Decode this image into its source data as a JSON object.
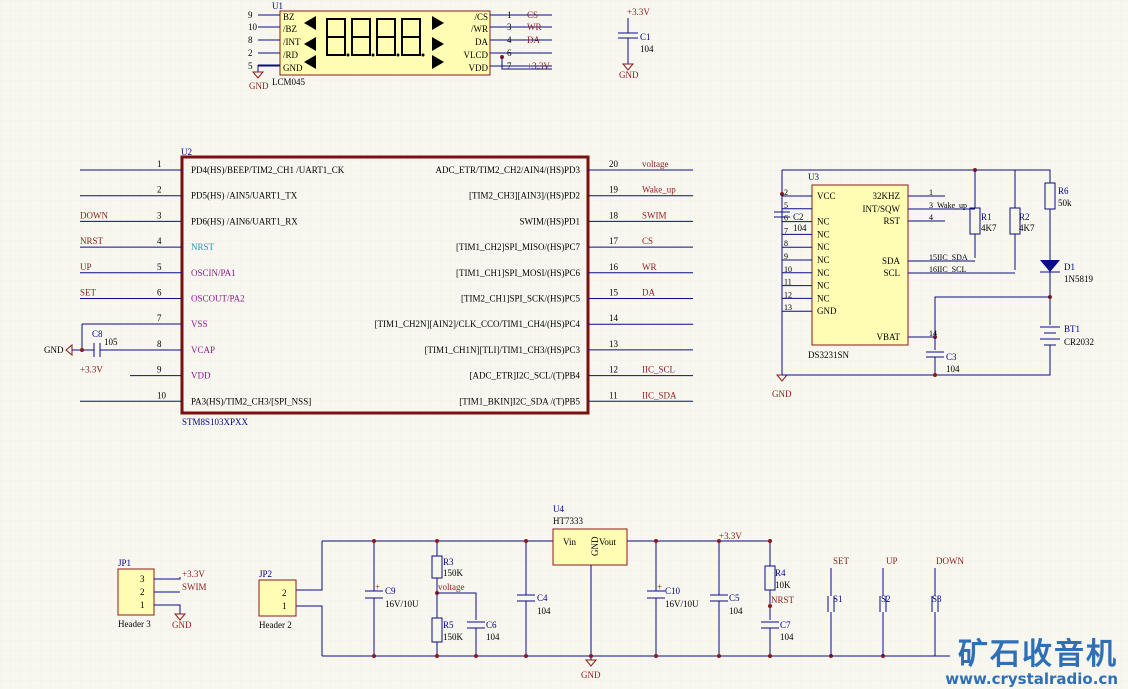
{
  "colors": {
    "wire": "#0b0b8c",
    "part_fill": "#fffdb4",
    "part_border": "#8b1a1a",
    "pin": "#000000",
    "label": "#000000",
    "ref": "#000080",
    "net": "#8b1a1a",
    "power": "#8b1a1a",
    "junction": "#8b1a1a",
    "mcu_border": "#7a1010",
    "watermark": "#2f6fb5"
  },
  "u1": {
    "ref": "U1",
    "value": "LCM045",
    "left_pins": [
      {
        "num": "9",
        "name": "BZ"
      },
      {
        "num": "10",
        "name": "/BZ"
      },
      {
        "num": "8",
        "name": "/INT"
      },
      {
        "num": "2",
        "name": "/RD"
      },
      {
        "num": "5",
        "name": "GND"
      }
    ],
    "right_pins": [
      {
        "num": "1",
        "name": "/CS",
        "net": "CS"
      },
      {
        "num": "3",
        "name": "/WR",
        "net": "WR"
      },
      {
        "num": "4",
        "name": "DA",
        "net": "DA"
      },
      {
        "num": "6",
        "name": "VLCD",
        "net": ""
      },
      {
        "num": "7",
        "name": "VDD",
        "net": "+3.3V"
      }
    ]
  },
  "gnd_label": "GND",
  "vcc_label": "+3.3V",
  "c1": {
    "ref": "C1",
    "value": "104"
  },
  "u2": {
    "ref": "U2",
    "value": "STM8S103XPXX",
    "left_pins": [
      {
        "num": "1",
        "name": "PD4(HS)/BEEP/TIM2_CH1 /UART1_CK",
        "net": ""
      },
      {
        "num": "2",
        "name": "PD5(HS) /AIN5/UART1_TX",
        "net": ""
      },
      {
        "num": "3",
        "name": "PD6(HS) /AIN6/UART1_RX",
        "net": "DOWN"
      },
      {
        "num": "4",
        "name": "NRST",
        "net": "NRST"
      },
      {
        "num": "5",
        "name": "OSCIN/PA1",
        "net": "UP"
      },
      {
        "num": "6",
        "name": "OSCOUT/PA2",
        "net": "SET"
      },
      {
        "num": "7",
        "name": "VSS",
        "net": ""
      },
      {
        "num": "8",
        "name": "VCAP",
        "net": ""
      },
      {
        "num": "9",
        "name": "VDD",
        "net": "+3.3V"
      },
      {
        "num": "10",
        "name": "PA3(HS)/TIM2_CH3/[SPI_NSS]",
        "net": ""
      }
    ],
    "right_pins": [
      {
        "num": "20",
        "name": "ADC_ETR/TIM2_CH2/AIN4/(HS)PD3",
        "net": "voltage"
      },
      {
        "num": "19",
        "name": "[TIM2_CH3][AIN3]/(HS)PD2",
        "net": "Wake_up"
      },
      {
        "num": "18",
        "name": "SWIM/(HS)PD1",
        "net": "SWIM"
      },
      {
        "num": "17",
        "name": "[TIM1_CH2]SPI_MISO/(HS)PC7",
        "net": "CS"
      },
      {
        "num": "16",
        "name": "[TIM1_CH1]SPI_MOSI/(HS)PC6",
        "net": "WR"
      },
      {
        "num": "15",
        "name": "[TIM2_CH1]SPI_SCK/(HS)PC5",
        "net": "DA"
      },
      {
        "num": "14",
        "name": "[TIM1_CH2N][AIN2]/CLK_CCO/TIM1_CH4/(HS)PC4",
        "net": ""
      },
      {
        "num": "13",
        "name": "[TIM1_CH1N][TLI]/TIM1_CH3/(HS)PC3",
        "net": ""
      },
      {
        "num": "12",
        "name": "[ADC_ETR]I2C_SCL/(T)PB4",
        "net": "IIC_SCL"
      },
      {
        "num": "11",
        "name": "[TIM1_BKIN]I2C_SDA /(T)PB5",
        "net": "IIC_SDA"
      }
    ]
  },
  "c8": {
    "ref": "C8",
    "value": "105"
  },
  "u3": {
    "ref": "U3",
    "value": "DS3231SN",
    "left_pins": [
      {
        "num": "2",
        "name": "VCC"
      },
      {
        "num": "5",
        "name": ""
      },
      {
        "num": "6",
        "name": "NC"
      },
      {
        "num": "7",
        "name": "NC"
      },
      {
        "num": "8",
        "name": "NC"
      },
      {
        "num": "9",
        "name": "NC"
      },
      {
        "num": "10",
        "name": "NC"
      },
      {
        "num": "11",
        "name": "NC"
      },
      {
        "num": "12",
        "name": "NC"
      },
      {
        "num": "13",
        "name": "GND"
      }
    ],
    "right_pins": [
      {
        "num": "1",
        "name": "32KHZ",
        "net": ""
      },
      {
        "num": "3",
        "name": "INT/SQW",
        "net": "Wake_up"
      },
      {
        "num": "4",
        "name": "RST",
        "net": ""
      },
      {
        "num": "15",
        "name": "SDA",
        "net": "IIC_SDA"
      },
      {
        "num": "16",
        "name": "SCL",
        "net": "IIC_SCL"
      },
      {
        "num": "14",
        "name": "VBAT",
        "net": ""
      }
    ]
  },
  "c2": {
    "ref": "C2",
    "value": "104"
  },
  "c3": {
    "ref": "C3",
    "value": "104"
  },
  "r1": {
    "ref": "R1",
    "value": "4K7"
  },
  "r2": {
    "ref": "R2",
    "value": "4K7"
  },
  "r6": {
    "ref": "R6",
    "value": "50k"
  },
  "d1": {
    "ref": "D1",
    "value": "1N5819"
  },
  "bt1": {
    "ref": "BT1",
    "value": "CR2032"
  },
  "u4": {
    "ref": "U4",
    "value": "HT7333",
    "pins": [
      "Vin",
      "GND",
      "Vout"
    ]
  },
  "jp1": {
    "ref": "JP1",
    "value": "Header 3",
    "pins": [
      "3",
      "2",
      "1"
    ],
    "nets": [
      "+3.3V",
      "SWIM",
      "GND"
    ]
  },
  "jp2": {
    "ref": "JP2",
    "value": "Header 2",
    "pins": [
      "2",
      "1"
    ]
  },
  "c9": {
    "ref": "C9",
    "value": "16V/10U"
  },
  "r3": {
    "ref": "R3",
    "value": "150K"
  },
  "r5": {
    "ref": "R5",
    "value": "150K"
  },
  "c6": {
    "ref": "C6",
    "value": "104"
  },
  "c4": {
    "ref": "C4",
    "value": "104"
  },
  "c10": {
    "ref": "C10",
    "value": "16V/10U"
  },
  "c5": {
    "ref": "C5",
    "value": "104"
  },
  "r4": {
    "ref": "R4",
    "value": "10K"
  },
  "c7": {
    "ref": "C7",
    "value": "104"
  },
  "nets_misc": {
    "voltage": "voltage",
    "nrst": "NRST",
    "set": "SET",
    "up": "UP",
    "down": "DOWN"
  },
  "s1": {
    "ref": "S1"
  },
  "s2": {
    "ref": "S2"
  },
  "s3": {
    "ref": "S3"
  },
  "watermark": {
    "cn": "矿石收音机",
    "url": "www.crystalradio.cn"
  }
}
